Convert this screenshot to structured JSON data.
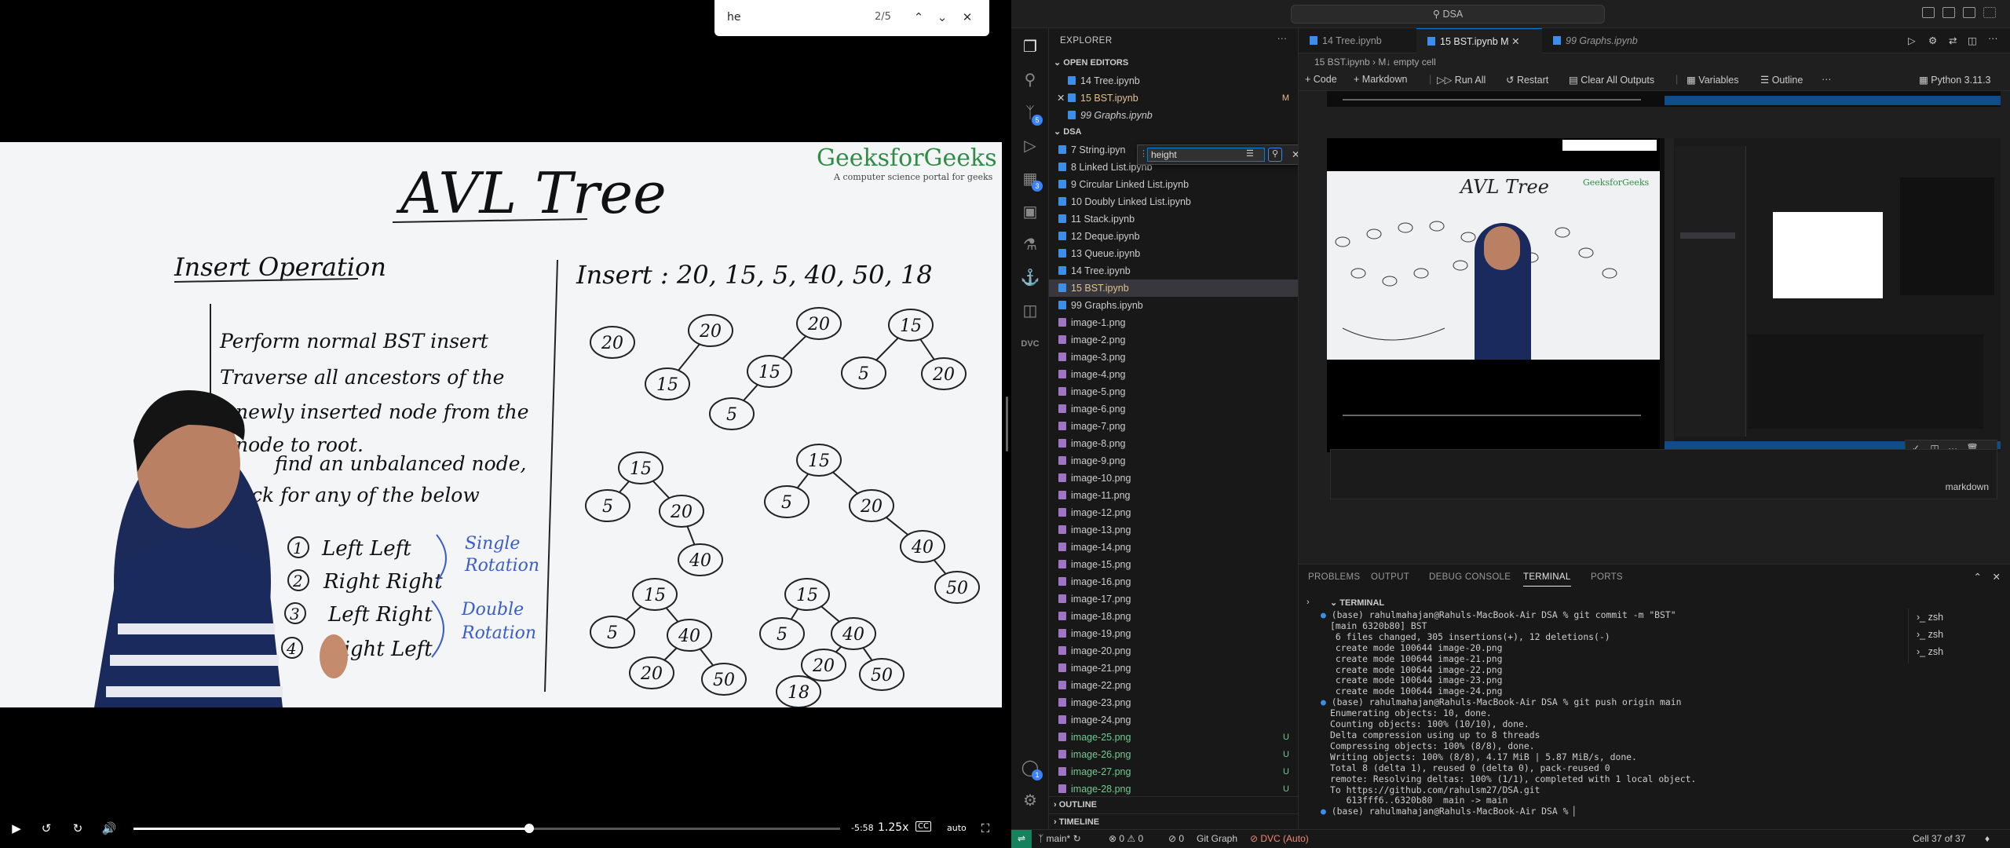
{
  "video": {
    "findbar": {
      "query": "he",
      "count": "2/5"
    },
    "board": {
      "title": "AVL Tree",
      "brand": "GeeksforGeeks",
      "brand_tagline": "A computer science portal for geeks",
      "heading": "Insert Operation",
      "steps": [
        "Perform normal BST insert",
        "Traverse all ancestors of the",
        "newly inserted node from the",
        "node to root.",
        "find an unbalanced node,",
        "ck for any of the below"
      ],
      "cases": [
        "Left Left",
        "Right Right",
        "Left Right",
        "Right Left"
      ],
      "single": [
        "Single",
        "Rotation"
      ],
      "double": [
        "Double",
        "Rotation"
      ],
      "insert_seq": "Insert : 20, 15, 5, 40, 50, 18",
      "nodes": [
        "20",
        "20",
        "15",
        "20",
        "15",
        "5",
        "15",
        "5",
        "20",
        "15",
        "5",
        "20",
        "40",
        "15",
        "5",
        "20",
        "40",
        "50",
        "15",
        "5",
        "40",
        "20",
        "50",
        "15",
        "5",
        "40",
        "20",
        "50",
        "18"
      ]
    },
    "controls": {
      "time": "-5:58",
      "speed": "1.25x",
      "quality": "auto",
      "cc": "CC",
      "progress": 0.56
    }
  },
  "vscode": {
    "search": "DSA",
    "explorer": {
      "title": "EXPLORER",
      "open_editors_label": "OPEN EDITORS",
      "open_editors": [
        {
          "name": "14 Tree.ipynb",
          "mark": ""
        },
        {
          "name": "15 BST.ipynb",
          "mark": "M"
        },
        {
          "name": "99 Graphs.ipynb",
          "mark": ""
        }
      ],
      "folder_label": "DSA",
      "files": [
        {
          "name": "7 String.ipyn",
          "mark": "",
          "type": "nb"
        },
        {
          "name": "8 Linked List.ipynb",
          "mark": "",
          "type": "nb"
        },
        {
          "name": "9 Circular Linked List.ipynb",
          "mark": "",
          "type": "nb"
        },
        {
          "name": "10 Doubly Linked List.ipynb",
          "mark": "",
          "type": "nb"
        },
        {
          "name": "11 Stack.ipynb",
          "mark": "",
          "type": "nb"
        },
        {
          "name": "12 Deque.ipynb",
          "mark": "",
          "type": "nb"
        },
        {
          "name": "13 Queue.ipynb",
          "mark": "",
          "type": "nb"
        },
        {
          "name": "14 Tree.ipynb",
          "mark": "",
          "type": "nb"
        },
        {
          "name": "15 BST.ipynb",
          "mark": "",
          "type": "nb",
          "selected": true
        },
        {
          "name": "99 Graphs.ipynb",
          "mark": "",
          "type": "nb"
        },
        {
          "name": "image-1.png",
          "mark": "",
          "type": "img"
        },
        {
          "name": "image-2.png",
          "mark": "",
          "type": "img"
        },
        {
          "name": "image-3.png",
          "mark": "",
          "type": "img"
        },
        {
          "name": "image-4.png",
          "mark": "",
          "type": "img"
        },
        {
          "name": "image-5.png",
          "mark": "",
          "type": "img"
        },
        {
          "name": "image-6.png",
          "mark": "",
          "type": "img"
        },
        {
          "name": "image-7.png",
          "mark": "",
          "type": "img"
        },
        {
          "name": "image-8.png",
          "mark": "",
          "type": "img"
        },
        {
          "name": "image-9.png",
          "mark": "",
          "type": "img"
        },
        {
          "name": "image-10.png",
          "mark": "",
          "type": "img"
        },
        {
          "name": "image-11.png",
          "mark": "",
          "type": "img"
        },
        {
          "name": "image-12.png",
          "mark": "",
          "type": "img"
        },
        {
          "name": "image-13.png",
          "mark": "",
          "type": "img"
        },
        {
          "name": "image-14.png",
          "mark": "",
          "type": "img"
        },
        {
          "name": "image-15.png",
          "mark": "",
          "type": "img"
        },
        {
          "name": "image-16.png",
          "mark": "",
          "type": "img"
        },
        {
          "name": "image-17.png",
          "mark": "",
          "type": "img"
        },
        {
          "name": "image-18.png",
          "mark": "",
          "type": "img"
        },
        {
          "name": "image-19.png",
          "mark": "",
          "type": "img"
        },
        {
          "name": "image-20.png",
          "mark": "",
          "type": "img"
        },
        {
          "name": "image-21.png",
          "mark": "",
          "type": "img"
        },
        {
          "name": "image-22.png",
          "mark": "",
          "type": "img"
        },
        {
          "name": "image-23.png",
          "mark": "",
          "type": "img"
        },
        {
          "name": "image-24.png",
          "mark": "",
          "type": "img"
        },
        {
          "name": "image-25.png",
          "mark": "U",
          "type": "img",
          "new": true
        },
        {
          "name": "image-26.png",
          "mark": "U",
          "type": "img",
          "new": true
        },
        {
          "name": "image-27.png",
          "mark": "U",
          "type": "img",
          "new": true
        },
        {
          "name": "image-28.png",
          "mark": "U",
          "type": "img",
          "new": true
        }
      ],
      "outline_label": "OUTLINE",
      "timeline_label": "TIMELINE",
      "find_value": "height"
    },
    "tabs": [
      {
        "name": "14 Tree.ipynb",
        "mark": ""
      },
      {
        "name": "15 BST.ipynb",
        "mark": "M"
      },
      {
        "name": "99 Graphs.ipynb",
        "mark": ""
      }
    ],
    "breadcrumb": {
      "file": "15 BST.ipynb",
      "cell": "M↓ empty cell"
    },
    "notebook_toolbar": {
      "code": "Code",
      "markdown": "Markdown",
      "run_all": "Run All",
      "restart": "Restart",
      "clear": "Clear All Outputs",
      "variables": "Variables",
      "outline": "Outline",
      "more": "···",
      "kernel": "Python 3.11.3"
    },
    "md_cell_lang": "markdown",
    "panel": {
      "tabs": [
        "PROBLEMS",
        "OUTPUT",
        "DEBUG CONSOLE",
        "TERMINAL",
        "PORTS"
      ],
      "terminal_label": "TERMINAL",
      "terminal_lines": [
        "(base) rahulmahajan@Rahuls-MacBook-Air DSA % git commit -m \"BST\"",
        "[main 6320b80] BST",
        " 6 files changed, 305 insertions(+), 12 deletions(-)",
        " create mode 100644 image-20.png",
        " create mode 100644 image-21.png",
        " create mode 100644 image-22.png",
        " create mode 100644 image-23.png",
        " create mode 100644 image-24.png",
        "(base) rahulmahajan@Rahuls-MacBook-Air DSA % git push origin main",
        "Enumerating objects: 10, done.",
        "Counting objects: 100% (10/10), done.",
        "Delta compression using up to 8 threads",
        "Compressing objects: 100% (8/8), done.",
        "Writing objects: 100% (8/8), 4.17 MiB | 5.87 MiB/s, done.",
        "Total 8 (delta 1), reused 0 (delta 0), pack-reused 0",
        "remote: Resolving deltas: 100% (1/1), completed with 1 local object.",
        "To https://github.com/rahulsm27/DSA.git",
        "   613fff6..6320b80  main -> main",
        "(base) rahulmahajan@Rahuls-MacBook-Air DSA % "
      ],
      "shells": [
        "zsh",
        "zsh",
        "zsh"
      ]
    },
    "status": {
      "branch": "main*",
      "errors": "0",
      "warnings": "0",
      "ports": "0",
      "git_graph": "Git Graph",
      "dvc": "DVC (Auto)",
      "cell": "Cell 37 of 37"
    },
    "accent": "#0078d4",
    "badges": {
      "scm": "5",
      "extensions": "3",
      "account": "1"
    }
  }
}
